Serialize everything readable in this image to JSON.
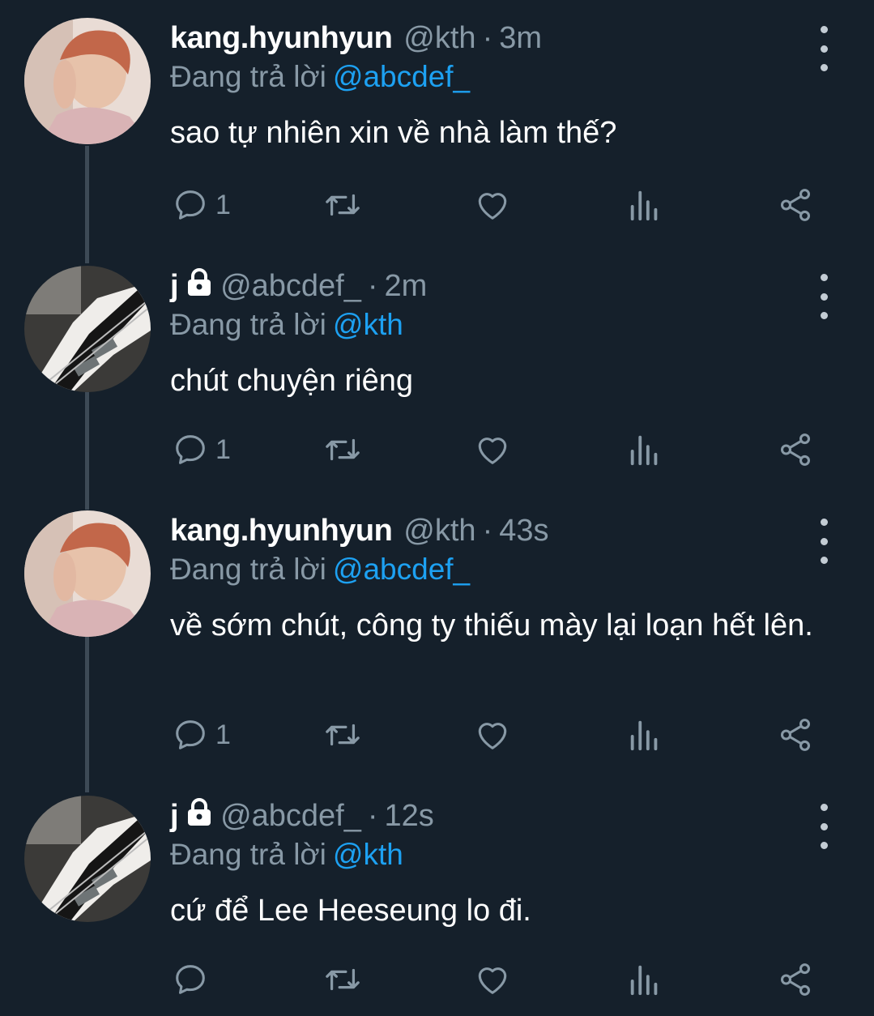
{
  "colors": {
    "background": "#15202b",
    "secondary_text": "#8899a6",
    "mention": "#1da1f2",
    "thread_line": "#3d4a56"
  },
  "tweets": [
    {
      "name": "kang.hyunhyun",
      "locked": false,
      "handle": "@kth",
      "separator": "·",
      "time": "3m",
      "reply_prefix": "Đang trả lời",
      "reply_to": "@abcdef_",
      "text": "sao tự nhiên xin về nhà làm thế?",
      "reply_count": "1",
      "avatar": "portrait-photo"
    },
    {
      "name": "j",
      "locked": true,
      "handle": "@abcdef_",
      "separator": "·",
      "time": "2m",
      "reply_prefix": "Đang trả lời",
      "reply_to": "@kth",
      "text": "chút chuyện riêng",
      "reply_count": "1",
      "avatar": "bass-guitar-photo"
    },
    {
      "name": "kang.hyunhyun",
      "locked": false,
      "handle": "@kth",
      "separator": "·",
      "time": "43s",
      "reply_prefix": "Đang trả lời",
      "reply_to": "@abcdef_",
      "text": "về sớm chút, công ty thiếu mày lại loạn hết lên.",
      "reply_count": "1",
      "avatar": "portrait-photo"
    },
    {
      "name": "j",
      "locked": true,
      "handle": "@abcdef_",
      "separator": "·",
      "time": "12s",
      "reply_prefix": "Đang trả lời",
      "reply_to": "@kth",
      "text": "cứ để Lee Heeseung lo đi.",
      "reply_count": "",
      "avatar": "bass-guitar-photo"
    }
  ]
}
